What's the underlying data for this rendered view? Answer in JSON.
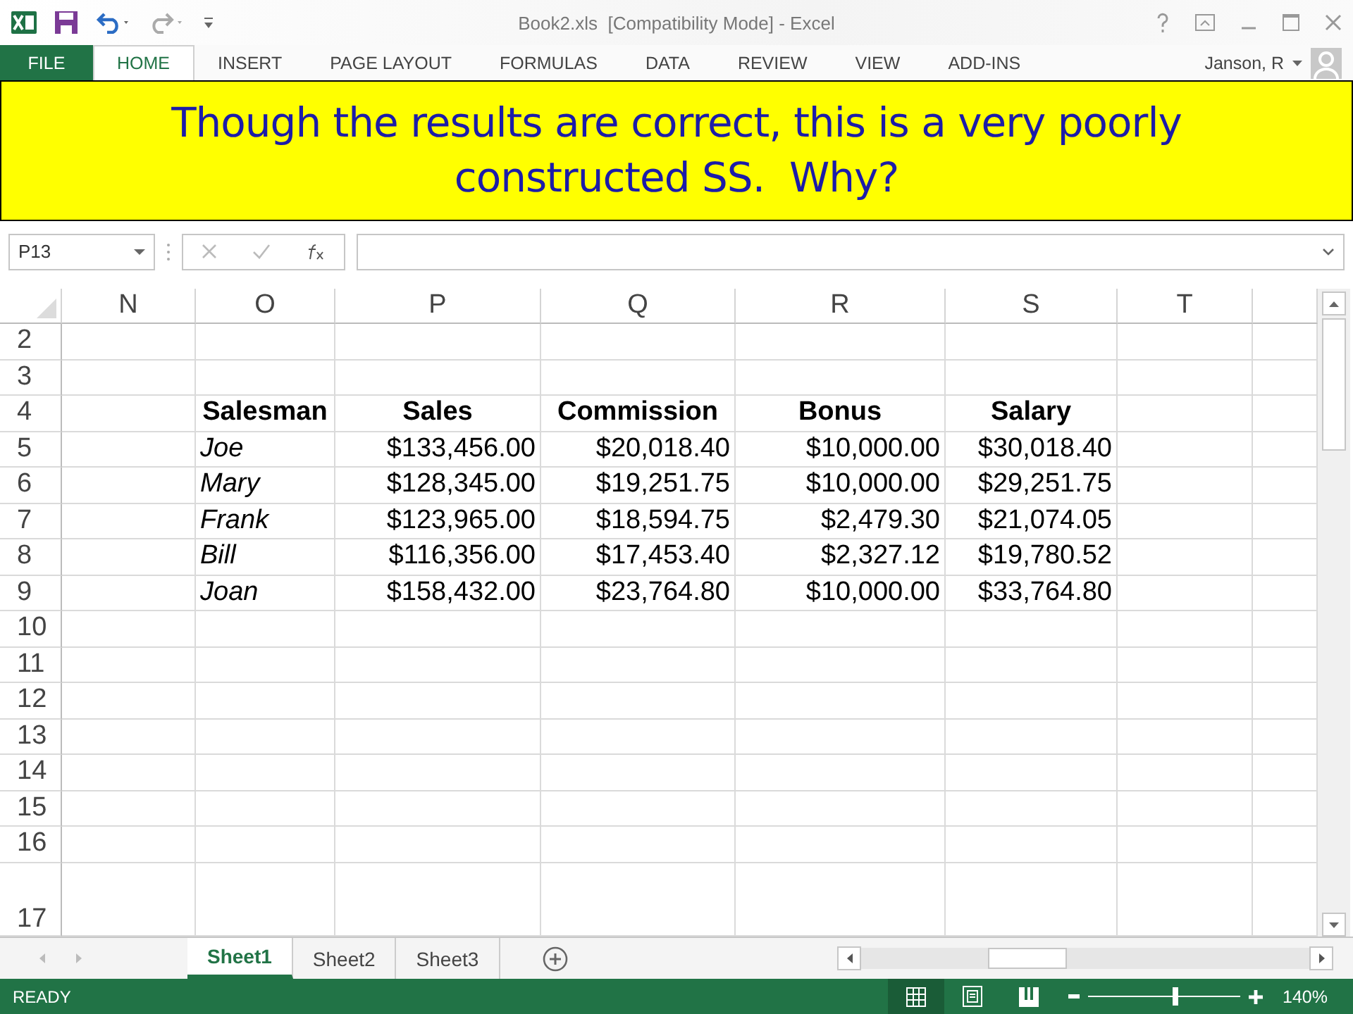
{
  "window": {
    "title": "Book2.xls  [Compatibility Mode] - Excel"
  },
  "ribbon_tabs": [
    {
      "label": "FILE",
      "kind": "file",
      "selected": false
    },
    {
      "label": "HOME",
      "kind": "tab",
      "selected": true
    },
    {
      "label": "INSERT",
      "kind": "tab",
      "selected": false
    },
    {
      "label": "PAGE LAYOUT",
      "kind": "tab",
      "selected": false
    },
    {
      "label": "FORMULAS",
      "kind": "tab",
      "selected": false
    },
    {
      "label": "DATA",
      "kind": "tab",
      "selected": false
    },
    {
      "label": "REVIEW",
      "kind": "tab",
      "selected": false
    },
    {
      "label": "VIEW",
      "kind": "tab",
      "selected": false
    },
    {
      "label": "ADD-INS",
      "kind": "tab",
      "selected": false
    }
  ],
  "user": {
    "name": "Janson, R"
  },
  "banner": {
    "text": "Though the results are correct, this is a very poorly constructed SS.  Why?"
  },
  "formula_bar": {
    "name_box": "P13"
  },
  "sheet": {
    "columns": [
      "N",
      "O",
      "P",
      "Q",
      "R",
      "S",
      "T"
    ],
    "row_numbers": [
      "2",
      "3",
      "4",
      "5",
      "6",
      "7",
      "8",
      "9",
      "10",
      "11",
      "12",
      "13",
      "14",
      "15",
      "16",
      "17"
    ],
    "header": [
      "Salesman",
      "Sales",
      "Commission",
      "Bonus",
      "Salary"
    ],
    "records": [
      [
        "Joe",
        "$133,456.00",
        "$20,018.40",
        "$10,000.00",
        "$30,018.40"
      ],
      [
        "Mary",
        "$128,345.00",
        "$19,251.75",
        "$10,000.00",
        "$29,251.75"
      ],
      [
        "Frank",
        "$123,965.00",
        "$18,594.75",
        "$2,479.30",
        "$21,074.05"
      ],
      [
        "Bill",
        "$116,356.00",
        "$17,453.40",
        "$2,327.12",
        "$19,780.52"
      ],
      [
        "Joan",
        "$158,432.00",
        "$23,764.80",
        "$10,000.00",
        "$33,764.80"
      ]
    ]
  },
  "sheet_tabs": [
    {
      "label": "Sheet1",
      "selected": true
    },
    {
      "label": "Sheet2",
      "selected": false
    },
    {
      "label": "Sheet3",
      "selected": false
    }
  ],
  "status_bar": {
    "status": "READY",
    "views": [
      {
        "kind": "normal",
        "selected": true
      },
      {
        "kind": "page_layout",
        "selected": false
      },
      {
        "kind": "page_break",
        "selected": false
      }
    ],
    "zoom": {
      "level": 0.57,
      "reading": "140%"
    }
  }
}
